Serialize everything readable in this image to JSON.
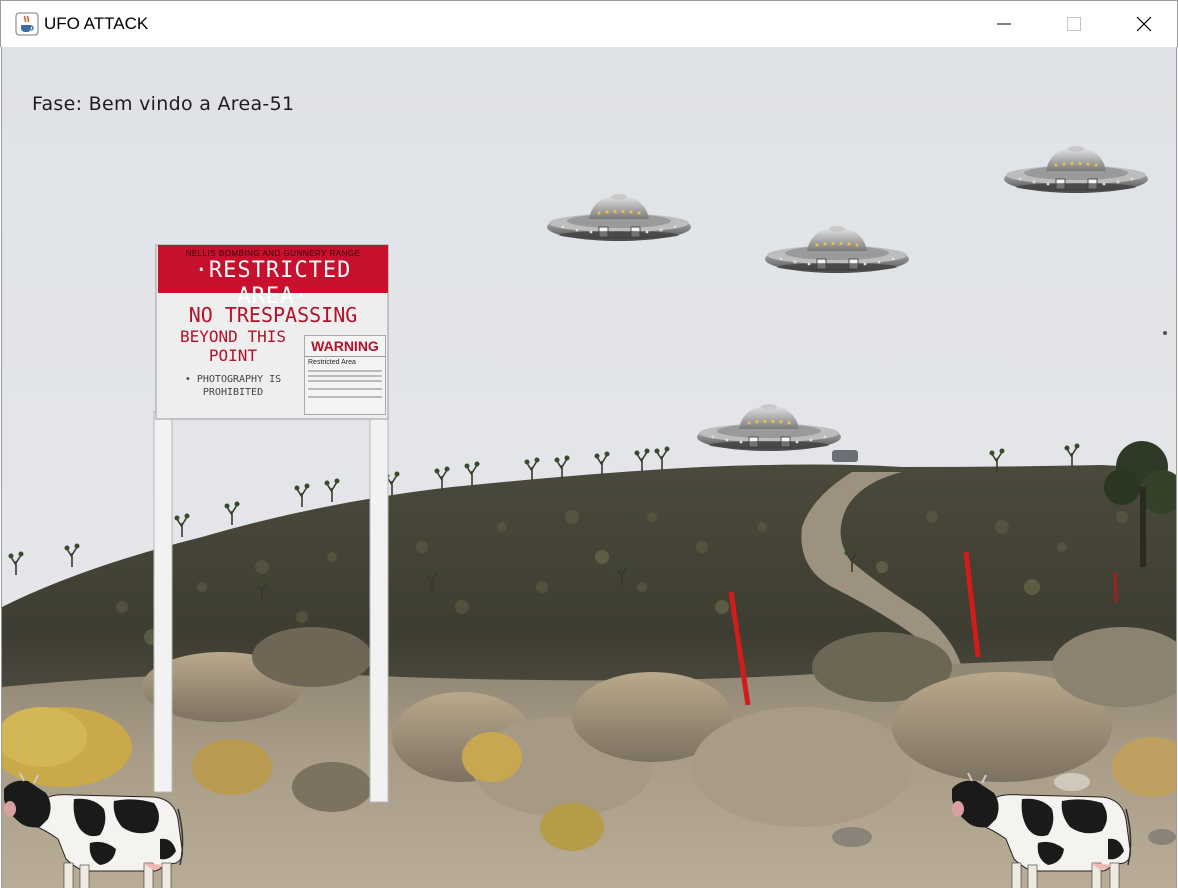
{
  "window": {
    "title": "UFO ATTACK",
    "app_icon": "java-cup-icon",
    "controls": [
      "minimize-icon",
      "maximize-icon",
      "close-icon"
    ]
  },
  "hud": {
    "phase_text": "Fase: Bem vindo a Area-51"
  },
  "sign": {
    "top_line": "NELLIS BOMBING AND GUNNERY RANGE",
    "header": "·RESTRICTED AREA·",
    "line1": "NO TRESPASSING",
    "line2": "BEYOND THIS",
    "line3": "POINT",
    "line4": "• PHOTOGRAPHY IS",
    "line5": "PROHIBITED",
    "warning_title": "WARNING",
    "warning_subtitle": "Restricted Area"
  },
  "sprites": {
    "ufo_count": 4,
    "cow_count": 2
  },
  "colors": {
    "sign_red": "#c8102e",
    "sky": "#e2e4e8",
    "hill": "#3f3d33",
    "ground": "#b3a690"
  }
}
